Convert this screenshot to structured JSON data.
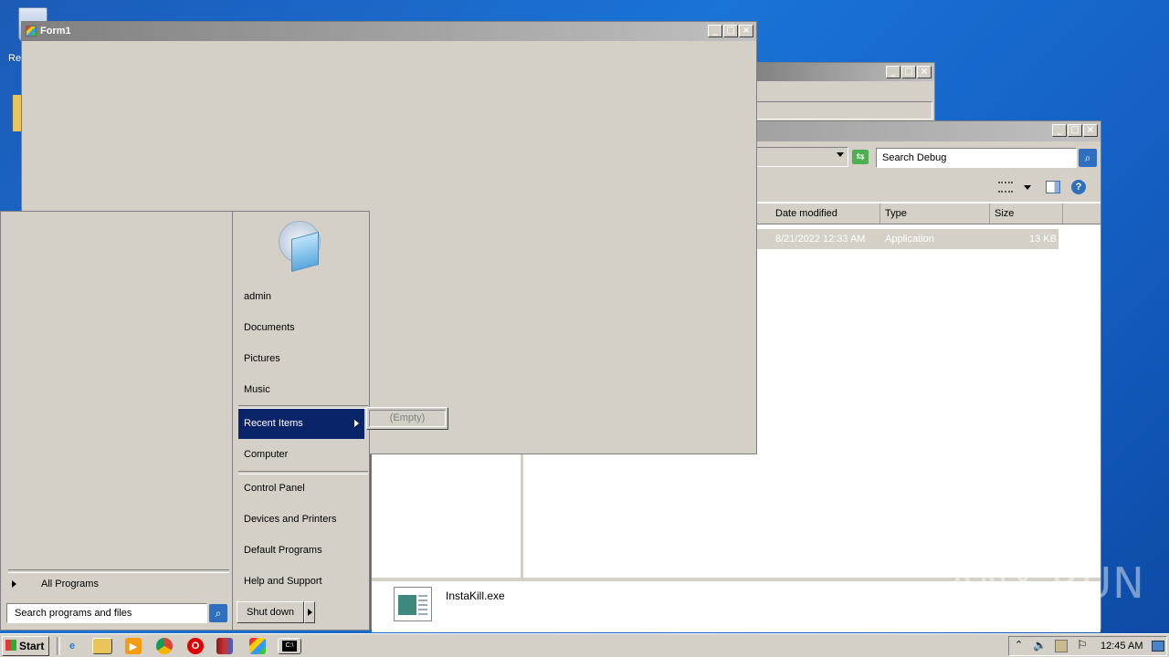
{
  "desktop": {
    "recycle_bin_label": "Re",
    "watermark": "ANY RUN"
  },
  "bg_window": {
    "title": ""
  },
  "explorer": {
    "search_placeholder": "Search Debug",
    "columns": [
      "Date modified",
      "Type",
      "Size"
    ],
    "rows": [
      {
        "date": "8/21/2022 12:33 AM",
        "type": "Application",
        "size": "13 KB"
      }
    ],
    "details_filename": "InstaKill.exe"
  },
  "form1": {
    "title": "Form1"
  },
  "start_menu": {
    "right_items": [
      {
        "label": "admin"
      },
      {
        "label": "Documents"
      },
      {
        "label": "Pictures"
      },
      {
        "label": "Music"
      },
      {
        "label": "Recent Items"
      },
      {
        "label": "Computer"
      },
      {
        "label": "Control Panel"
      },
      {
        "label": "Devices and Printers"
      },
      {
        "label": "Default Programs"
      },
      {
        "label": "Help and Support"
      }
    ],
    "recent_submenu": "(Empty)",
    "all_programs": "All Programs",
    "search_placeholder": "Search programs and files",
    "shutdown_label": "Shut down"
  },
  "taskbar": {
    "start_label": "Start",
    "clock": "12:45 AM"
  }
}
